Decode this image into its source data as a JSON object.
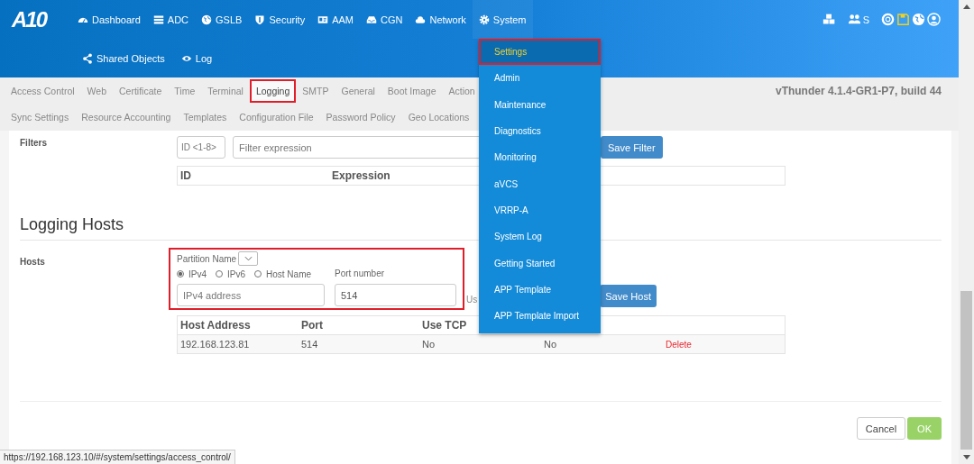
{
  "header": {
    "logo": "A10",
    "nav": [
      {
        "label": "Dashboard",
        "selected": false
      },
      {
        "label": "ADC",
        "selected": false
      },
      {
        "label": "GSLB",
        "selected": false
      },
      {
        "label": "Security",
        "selected": false
      },
      {
        "label": "AAM",
        "selected": false
      },
      {
        "label": "CGN",
        "selected": false
      },
      {
        "label": "Network",
        "selected": false
      },
      {
        "label": "System",
        "selected": true
      }
    ],
    "nav_row2": [
      "Shared Objects",
      "Log"
    ],
    "user_initial": "S"
  },
  "subnav": {
    "tabs_row_1": [
      {
        "label": "Access Control",
        "selected": false,
        "highlighted": false
      },
      {
        "label": "Web",
        "selected": false,
        "highlighted": false
      },
      {
        "label": "Certificate",
        "selected": false,
        "highlighted": false
      },
      {
        "label": "Time",
        "selected": false,
        "highlighted": false
      },
      {
        "label": "Terminal",
        "selected": false,
        "highlighted": false
      },
      {
        "label": "Logging",
        "selected": true,
        "highlighted": true
      },
      {
        "label": "SMTP",
        "selected": false,
        "highlighted": false
      },
      {
        "label": "General",
        "selected": false,
        "highlighted": false
      },
      {
        "label": "Boot Image",
        "selected": false,
        "highlighted": false
      },
      {
        "label": "Action",
        "selected": false,
        "highlighted": false
      }
    ],
    "tabs_row_2": [
      {
        "label": "Sync Settings",
        "selected": false,
        "highlighted": false
      },
      {
        "label": "Resource Accounting",
        "selected": false,
        "highlighted": false
      },
      {
        "label": "Templates",
        "selected": false,
        "highlighted": false
      },
      {
        "label": "Configuration File",
        "selected": false,
        "highlighted": false
      },
      {
        "label": "Password Policy",
        "selected": false,
        "highlighted": false
      },
      {
        "label": "Geo Locations",
        "selected": false,
        "highlighted": false
      }
    ],
    "version": "vThunder 4.1.4-GR1-P7, build 44"
  },
  "system_menu": {
    "items": [
      {
        "label": "Settings",
        "selected": true,
        "highlighted": true
      },
      {
        "label": "Admin",
        "selected": false,
        "highlighted": false
      },
      {
        "label": "Maintenance",
        "selected": false,
        "highlighted": false
      },
      {
        "label": "Diagnostics",
        "selected": false,
        "highlighted": false
      },
      {
        "label": "Monitoring",
        "selected": false,
        "highlighted": false
      },
      {
        "label": "aVCS",
        "selected": false,
        "highlighted": false
      },
      {
        "label": "VRRP-A",
        "selected": false,
        "highlighted": false
      },
      {
        "label": "System Log",
        "selected": false,
        "highlighted": false
      },
      {
        "label": "Getting Started",
        "selected": false,
        "highlighted": false
      },
      {
        "label": "APP Template",
        "selected": false,
        "highlighted": false
      },
      {
        "label": "APP Template Import",
        "selected": false,
        "highlighted": false
      }
    ]
  },
  "filters": {
    "label": "Filters",
    "id_placeholder": "ID <1-8>",
    "expression_placeholder": "Filter expression",
    "save_button": "Save Filter",
    "columns": [
      "ID",
      "Expression"
    ]
  },
  "logging_hosts": {
    "title": "Logging Hosts",
    "hosts_label": "Hosts",
    "form": {
      "highlighted": true,
      "partition_label": "Partition Name",
      "address_types": [
        {
          "label": "IPv4",
          "selected": true
        },
        {
          "label": "IPv6",
          "selected": false
        },
        {
          "label": "Host Name",
          "selected": false
        }
      ],
      "address_placeholder": "IPv4 address",
      "port_label": "Port number",
      "port_value": "514",
      "tcp_label": "Us",
      "save_button": "Save Host"
    },
    "table": {
      "columns": [
        "Host Address",
        "Port",
        "Use TCP"
      ],
      "rows": [
        {
          "cells": [
            "192.168.123.81",
            "514",
            "No",
            "No"
          ],
          "action": "Delete"
        }
      ]
    }
  },
  "footer": {
    "buttons": [
      {
        "label": "Cancel",
        "kind": "default"
      },
      {
        "label": "OK",
        "kind": "primary"
      }
    ]
  },
  "status_url": "https://192.168.123.10/#/system/settings/access_control/"
}
